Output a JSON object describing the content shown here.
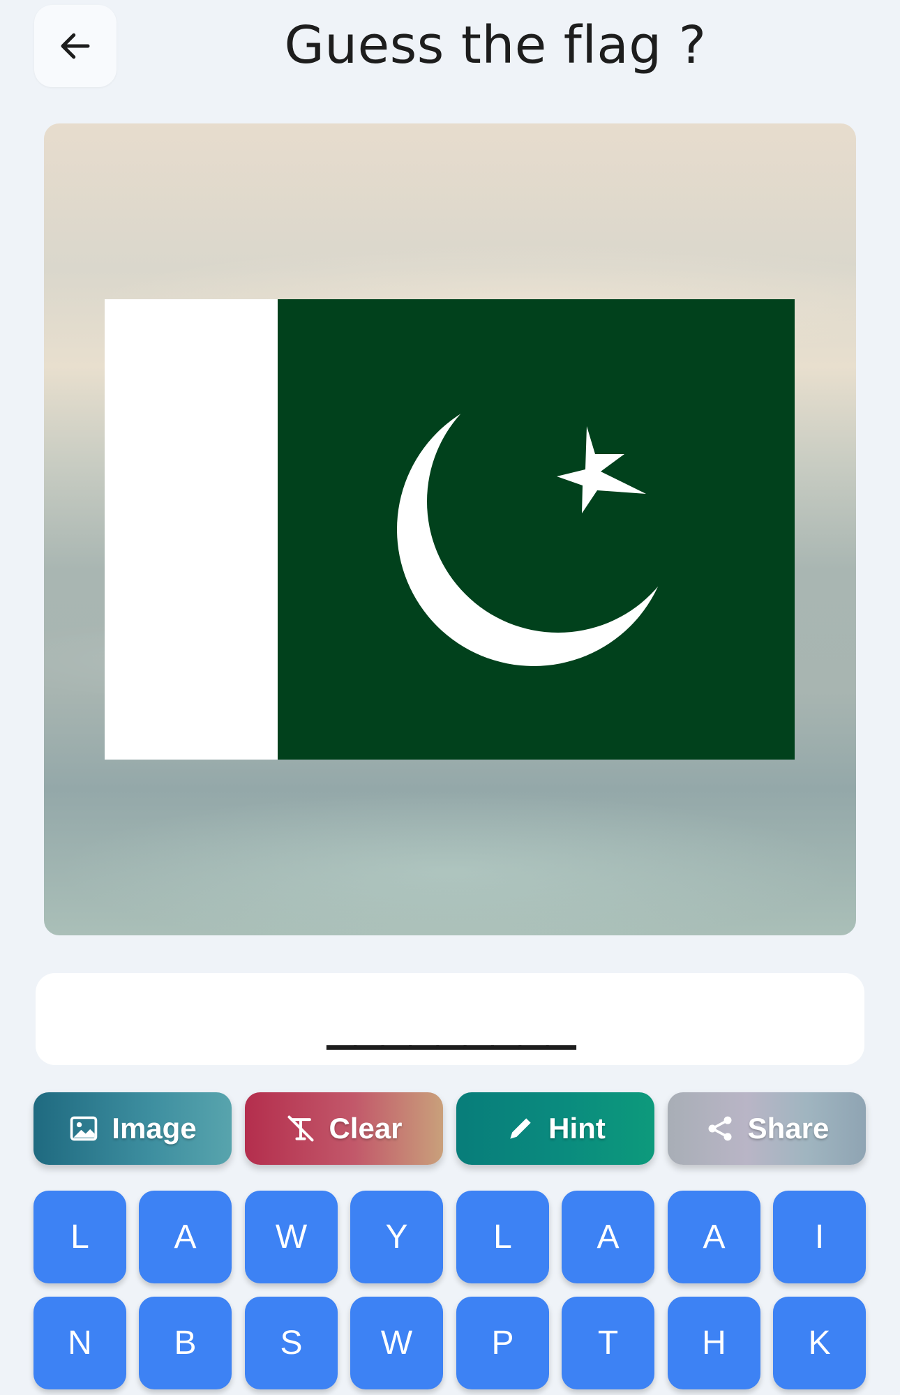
{
  "header": {
    "back_icon": "arrow-left-icon",
    "title": "Guess the flag ?"
  },
  "flag": {
    "country_colors": {
      "green": "#01411c",
      "white": "#ffffff"
    }
  },
  "answer": {
    "slots": "_________",
    "slot_count": 9
  },
  "actions": [
    {
      "label": "Image",
      "icon": "image-icon"
    },
    {
      "label": "Clear",
      "icon": "clear-format-icon"
    },
    {
      "label": "Hint",
      "icon": "pencil-icon"
    },
    {
      "label": "Share",
      "icon": "share-icon"
    }
  ],
  "keyboard": {
    "row1": [
      "L",
      "A",
      "W",
      "Y",
      "L",
      "A",
      "A",
      "I"
    ],
    "row2": [
      "N",
      "B",
      "S",
      "W",
      "P",
      "T",
      "H",
      "K"
    ],
    "key_color": "#3d82f4"
  }
}
